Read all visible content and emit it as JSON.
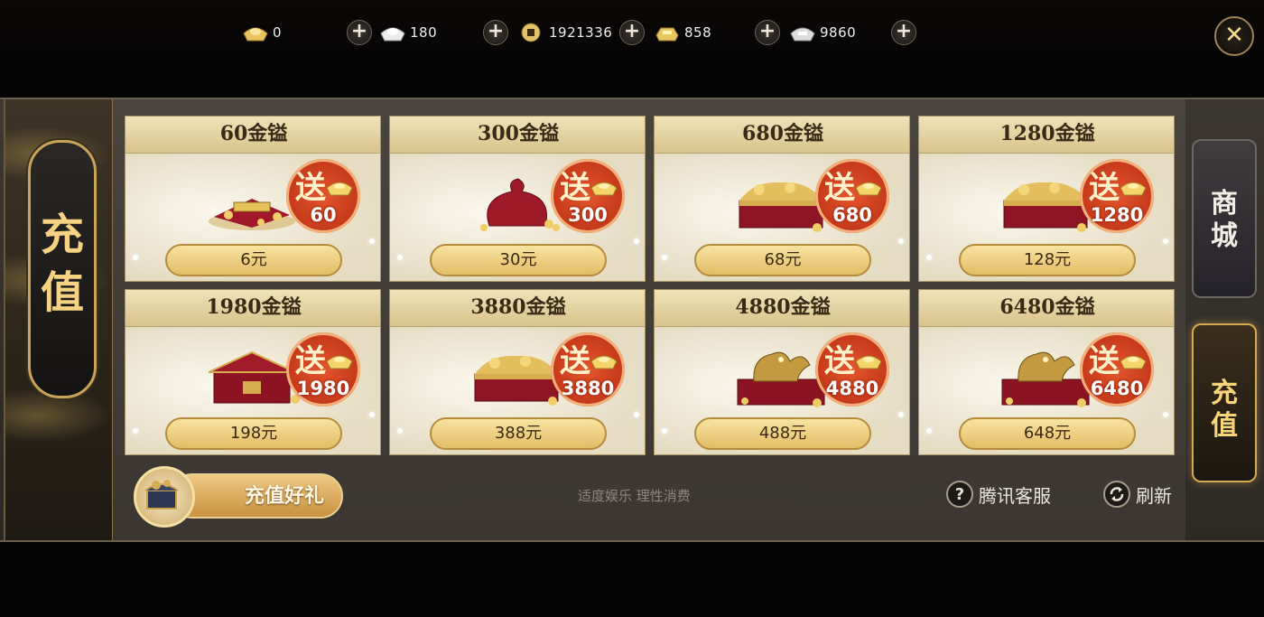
{
  "currencies": [
    {
      "name": "gold-ingot",
      "value": "0",
      "color": "#e7c56a"
    },
    {
      "name": "silver-ingot",
      "value": "180",
      "color": "#e8e8e8"
    },
    {
      "name": "copper-coin",
      "value": "1921336",
      "color": "#d9b85c"
    },
    {
      "name": "gold-bar",
      "value": "858",
      "color": "#e6c86e"
    },
    {
      "name": "silver-bar",
      "value": "9860",
      "color": "#dcdcdc"
    }
  ],
  "plus_label": "+",
  "close_label": "✕",
  "left_title": [
    "充",
    "值"
  ],
  "cards": [
    {
      "title": "60金镒",
      "bonus": "60",
      "price": "6元",
      "art": "small-pile"
    },
    {
      "title": "300金镒",
      "bonus": "300",
      "price": "30元",
      "art": "red-pouch"
    },
    {
      "title": "680金镒",
      "bonus": "680",
      "price": "68元",
      "art": "chest"
    },
    {
      "title": "1280金镒",
      "bonus": "1280",
      "price": "128元",
      "art": "chest"
    },
    {
      "title": "1980金镒",
      "bonus": "1980",
      "price": "198元",
      "art": "closed-box"
    },
    {
      "title": "3880金镒",
      "bonus": "3880",
      "price": "388元",
      "art": "chest"
    },
    {
      "title": "4880金镒",
      "bonus": "4880",
      "price": "488元",
      "art": "dragon-chest"
    },
    {
      "title": "6480金镒",
      "bonus": "6480",
      "price": "648元",
      "art": "dragon-chest"
    }
  ],
  "bonus_char": "送",
  "gift_label": "充值好礼",
  "notice": "适度娱乐 理性消费",
  "service_label": "腾讯客服",
  "service_icon": "?",
  "refresh_label": "刷新",
  "tabs": {
    "shop": [
      "商",
      "城"
    ],
    "recharge": [
      "充",
      "值"
    ]
  },
  "colors": {
    "accent": "#d4a94f",
    "card_bg": "#e9e0c9",
    "bonus_red": "#c9361a"
  }
}
